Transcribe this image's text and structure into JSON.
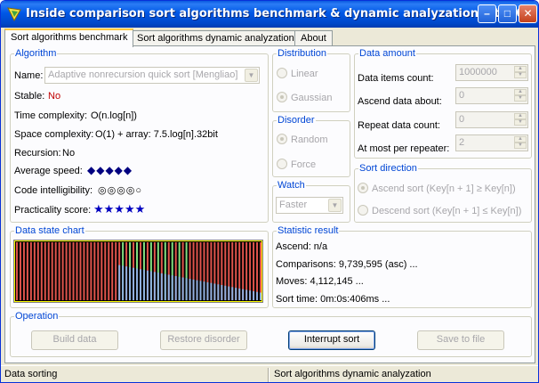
{
  "window": {
    "title": "Inside comparison sort algorithms benchmark & dynamic analyzation kit 1.0.1",
    "minimize_glyph": "–",
    "maximize_glyph": "□",
    "close_glyph": "✕"
  },
  "tabs": [
    {
      "label": "Sort algorithms benchmark",
      "active": true
    },
    {
      "label": "Sort algorithms dynamic analyzation",
      "active": false
    },
    {
      "label": "About",
      "active": false
    }
  ],
  "algorithm": {
    "legend": "Algorithm",
    "name_label": "Name:",
    "name_value": "Adaptive nonrecursion quick sort [Mengliao]",
    "stable_label": "Stable:",
    "stable_value": "No",
    "time_label": "Time complexity:",
    "time_value": "O(n.log[n])",
    "space_label": "Space complexity:",
    "space_value": "O(1) + array: 7.5.log[n].32bit",
    "recursion_label": "Recursion:",
    "recursion_value": "No",
    "speed_label": "Average speed:",
    "speed_value": "◆◆◆◆◆",
    "intelligibility_label": "Code intelligibility:",
    "intelligibility_value": "◎◎◎◎○",
    "practicality_label": "Practicality score:",
    "practicality_value": "★★★★★"
  },
  "distribution": {
    "legend": "Distribution",
    "options": [
      "Linear",
      "Gaussian"
    ],
    "selected": "Gaussian"
  },
  "disorder": {
    "legend": "Disorder",
    "options": [
      "Random",
      "Force"
    ],
    "selected": "Random"
  },
  "watch": {
    "legend": "Watch",
    "value": "Faster"
  },
  "data_amount": {
    "legend": "Data amount",
    "items_label": "Data items count:",
    "items_value": "1000000",
    "ascend_label": "Ascend data about:",
    "ascend_value": "0",
    "repeat_label": "Repeat data count:",
    "repeat_value": "0",
    "per_repeater_label": "At most per repeater:",
    "per_repeater_value": "2"
  },
  "sort_direction": {
    "legend": "Sort direction",
    "ascend_label": "Ascend sort (Key[n + 1] ≥ Key[n])",
    "descend_label": "Descend sort (Key[n + 1] ≤ Key[n])",
    "selected": "ascend"
  },
  "data_state_chart": {
    "legend": "Data state chart"
  },
  "statistic": {
    "legend": "Statistic result",
    "ascend": "Ascend:  n/a",
    "comparisons": "Comparisons: 9,739,595 (asc) ...",
    "moves": "Moves: 4,112,145 ...",
    "sort_time": "Sort time: 0m:0s:406ms ..."
  },
  "operation": {
    "legend": "Operation",
    "build_label": "Build data",
    "restore_label": "Restore disorder",
    "interrupt_label": "Interrupt sort",
    "save_label": "Save to file"
  },
  "status": {
    "left": "Data sorting",
    "right": "Sort algorithms dynamic analyzation"
  },
  "colors": {
    "title_bar": "#0058e6",
    "group_caption": "#0046d5",
    "stable_value": "#c00000",
    "chart_red": "#e0544c",
    "chart_green": "#80e080",
    "chart_blue": "#8fb0e0",
    "chart_border": "#ffff00"
  }
}
